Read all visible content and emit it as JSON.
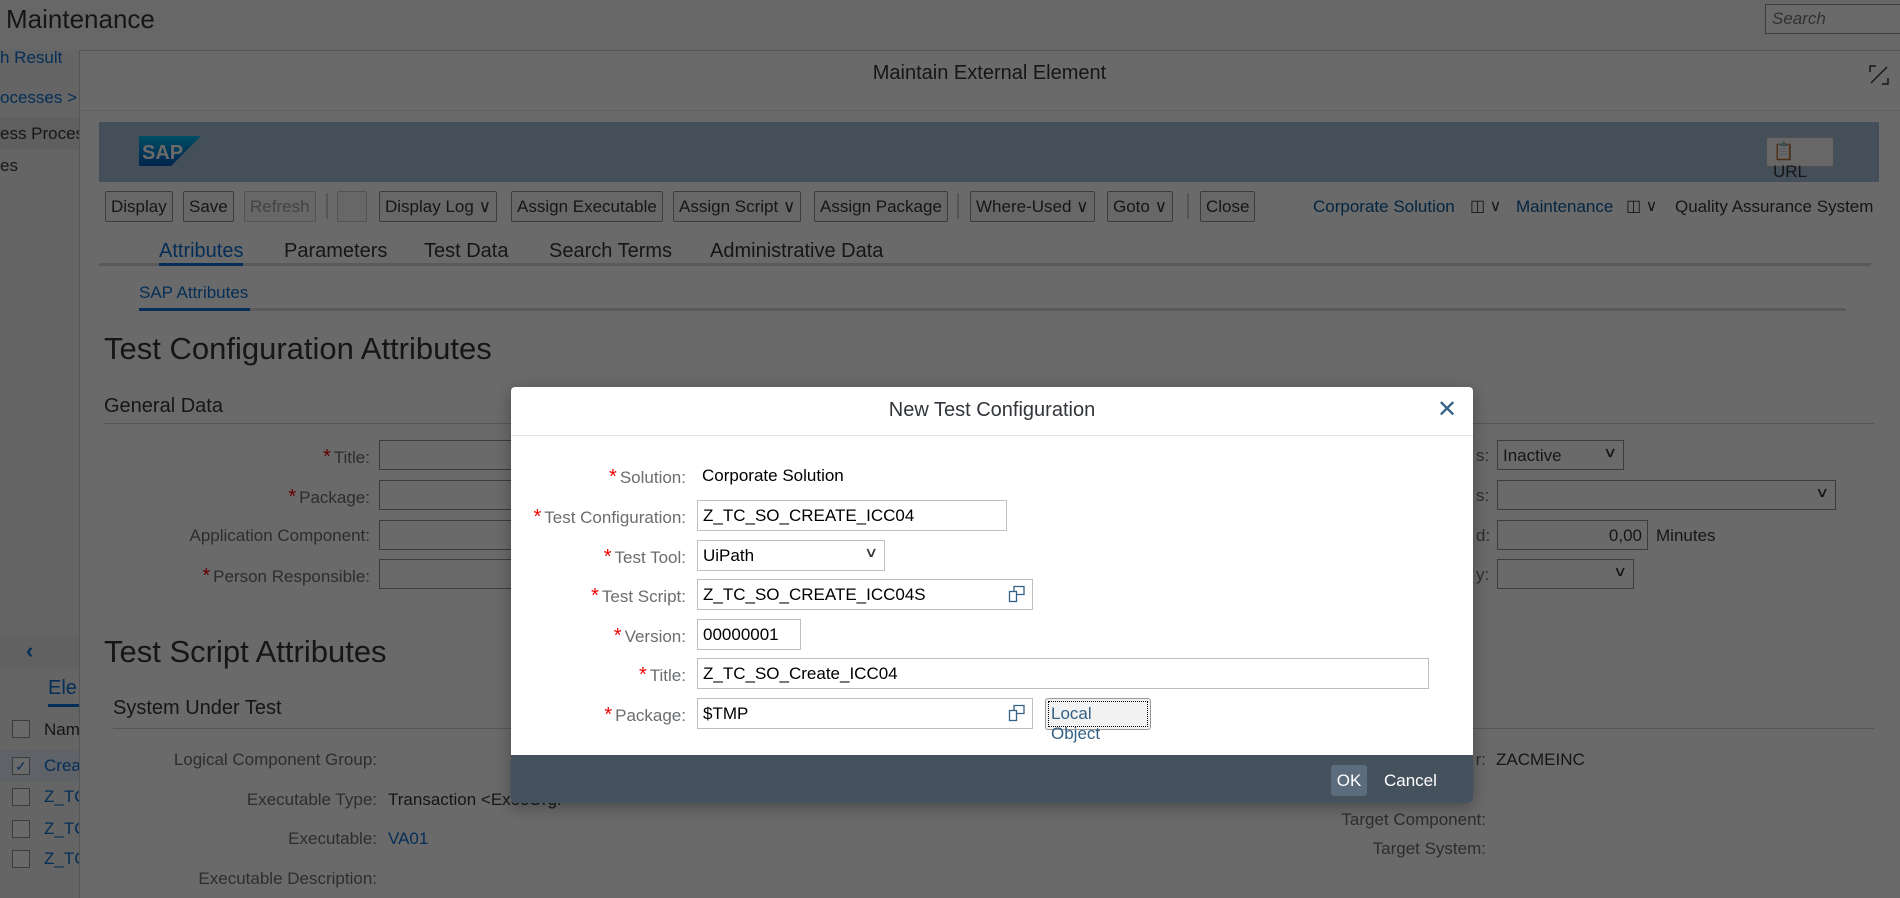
{
  "app": {
    "title": "Maintenance",
    "search_placeholder": "Search"
  },
  "left_panel": {
    "search_result": "h Result",
    "breadcrumb": "ocesses > U",
    "row1": "ess Proces",
    "row2": "es",
    "collapse_icon": "chevron-left-icon",
    "tab": "Ele",
    "table_header": "Nam",
    "rows": [
      {
        "name": "Crea",
        "checked": true
      },
      {
        "name": "Z_TC",
        "checked": false
      },
      {
        "name": "Z_TC",
        "checked": false
      },
      {
        "name": "Z_TC",
        "checked": false
      }
    ]
  },
  "external_dialog": {
    "title": "Maintain External Element",
    "url_button": "URL",
    "toolbar": {
      "display": "Display",
      "save": "Save",
      "refresh": "Refresh",
      "display_log": "Display Log",
      "assign_executable": "Assign Executable",
      "assign_script": "Assign Script",
      "assign_package": "Assign Package",
      "where_used": "Where-Used",
      "goto": "Goto",
      "close": "Close"
    },
    "context": {
      "solution": "Corporate Solution",
      "branch": "Maintenance",
      "system": "Quality Assurance System"
    },
    "tabs": [
      {
        "label": "Attributes",
        "active": true
      },
      {
        "label": "Parameters"
      },
      {
        "label": "Test Data"
      },
      {
        "label": "Search Terms"
      },
      {
        "label": "Administrative Data"
      }
    ],
    "subtab": "SAP Attributes",
    "section1": {
      "title": "Test Configuration Attributes",
      "group": "General Data",
      "fields": [
        "Title:",
        "Package:",
        "Application Component:",
        "Person Responsible:"
      ],
      "right": {
        "status_suffix": "s:",
        "status_value": "Inactive",
        "s2_suffix": "s:",
        "d_suffix": "d:",
        "duration": "0,00",
        "unit": "Minutes",
        "y_suffix": "y:"
      }
    },
    "section2": {
      "title": "Test Script Attributes",
      "group": "System Under Test",
      "logical_component_group": "Logical Component Group:",
      "executable_type_label": "Executable Type:",
      "executable_type_value": "Transaction <ExecOrg.",
      "executable_label": "Executable:",
      "executable_value": "VA01",
      "executable_desc": "Executable Description:",
      "r_suffix": "r:",
      "r_value": "ZACMEINC",
      "target_component": "Target Component:",
      "target_system": "Target System:"
    }
  },
  "modal": {
    "title": "New Test Configuration",
    "fields": {
      "solution": {
        "label": "Solution:",
        "value": "Corporate Solution"
      },
      "test_configuration": {
        "label": "Test Configuration:",
        "value": "Z_TC_SO_CREATE_ICC04"
      },
      "test_tool": {
        "label": "Test Tool:",
        "value": "UiPath"
      },
      "test_script": {
        "label": "Test Script:",
        "value": "Z_TC_SO_CREATE_ICC04S"
      },
      "version": {
        "label": "Version:",
        "value": "00000001"
      },
      "title": {
        "label": "Title:",
        "value": "Z_TC_SO_Create_ICC04"
      },
      "package": {
        "label": "Package:",
        "value": "$TMP"
      }
    },
    "local_object": "Local Object",
    "ok": "OK",
    "cancel": "Cancel",
    "required_marker": "*"
  }
}
